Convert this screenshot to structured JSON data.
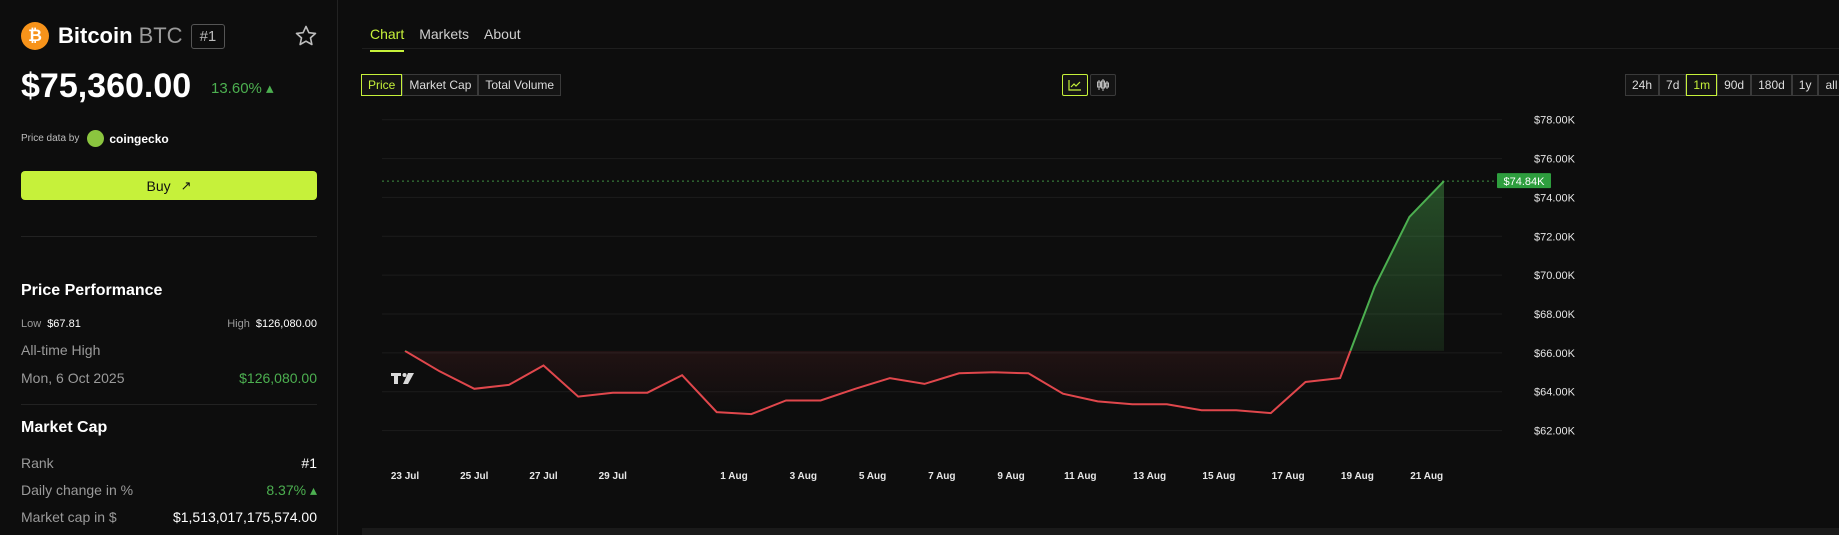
{
  "coin": {
    "logo_glyph": "₿",
    "name": "Bitcoin",
    "symbol": "BTC",
    "rank_badge": "#1",
    "price": "$75,360.00",
    "change": "13.60% ▴",
    "price_data_by": "Price data by",
    "provider": "coingecko",
    "buy_label": "Buy",
    "buy_arrow": "↗"
  },
  "performance": {
    "title": "Price Performance",
    "low_label": "Low",
    "low_value": "$67.81",
    "high_label": "High",
    "high_value": "$126,080.00",
    "ath_label": "All-time High",
    "ath_date": "Mon, 6 Oct 2025",
    "ath_value": "$126,080.00"
  },
  "market_cap": {
    "title": "Market Cap",
    "rank_label": "Rank",
    "rank_value": "#1",
    "daily_change_label": "Daily change in %",
    "daily_change_value": "8.37% ▴",
    "cap_label": "Market cap in $",
    "cap_value": "$1,513,017,175,574.00"
  },
  "tabs": [
    "Chart",
    "Markets",
    "About"
  ],
  "metric_buttons": [
    "Price",
    "Market Cap",
    "Total Volume"
  ],
  "range_buttons": [
    "24h",
    "7d",
    "1m",
    "90d",
    "180d",
    "1y",
    "all"
  ],
  "colors": {
    "accent": "#c6f13a",
    "up": "#4caf50",
    "down": "#e0474c",
    "bitcoin": "#f7931a"
  },
  "icons": {
    "star": "star-outline-icon",
    "line_chart": "line-chart-icon",
    "candle_chart": "candlestick-icon",
    "tradingview": "tradingview-logo"
  },
  "chart_data": {
    "type": "line",
    "x_ticks": [
      "23 Jul",
      "25 Jul",
      "27 Jul",
      "29 Jul",
      "1 Aug",
      "3 Aug",
      "5 Aug",
      "7 Aug",
      "9 Aug",
      "11 Aug",
      "13 Aug",
      "15 Aug",
      "17 Aug",
      "19 Aug",
      "21 Aug"
    ],
    "y_ticks": [
      "$78.00K",
      "$76.00K",
      "$74.00K",
      "$72.00K",
      "$70.00K",
      "$68.00K",
      "$66.00K",
      "$64.00K",
      "$62.00K"
    ],
    "ylim": [
      61000,
      78500
    ],
    "current_label": "$74.84K",
    "current_value": 74840,
    "baseline": 66100,
    "series": [
      {
        "values": [
          66100,
          65050,
          64150,
          64350,
          65350,
          63750,
          63950,
          63950,
          64850,
          62950,
          62850,
          63550,
          63550,
          64150,
          64700,
          64400,
          64950,
          65000,
          64950,
          63900,
          63500,
          63350,
          63350,
          63050,
          63050,
          62900,
          64500,
          64700,
          69400,
          73000,
          74840
        ]
      }
    ],
    "grid": true
  }
}
